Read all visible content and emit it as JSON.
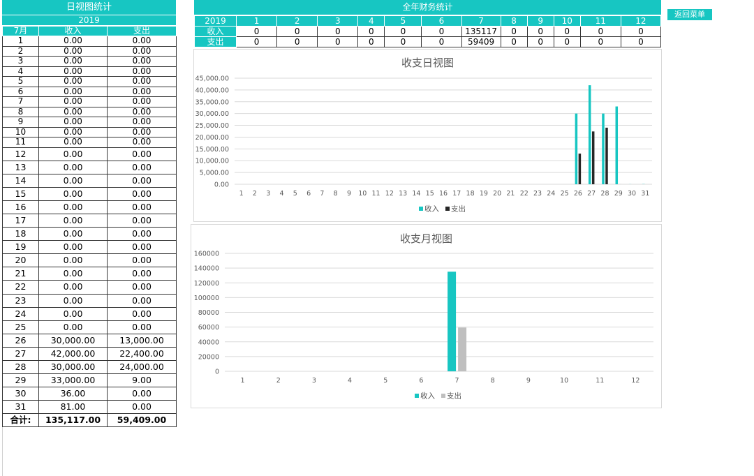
{
  "daily": {
    "title": "日视图统计",
    "year": "2019",
    "month_col": "7月",
    "income_col": "收入",
    "expense_col": "支出",
    "rows": [
      {
        "day": "1",
        "income": "0.00",
        "expense": "0.00"
      },
      {
        "day": "2",
        "income": "0.00",
        "expense": "0.00"
      },
      {
        "day": "3",
        "income": "0.00",
        "expense": "0.00"
      },
      {
        "day": "4",
        "income": "0.00",
        "expense": "0.00"
      },
      {
        "day": "5",
        "income": "0.00",
        "expense": "0.00"
      },
      {
        "day": "6",
        "income": "0.00",
        "expense": "0.00"
      },
      {
        "day": "7",
        "income": "0.00",
        "expense": "0.00"
      },
      {
        "day": "8",
        "income": "0.00",
        "expense": "0.00"
      },
      {
        "day": "9",
        "income": "0.00",
        "expense": "0.00"
      },
      {
        "day": "10",
        "income": "0.00",
        "expense": "0.00"
      },
      {
        "day": "11",
        "income": "0.00",
        "expense": "0.00"
      },
      {
        "day": "12",
        "income": "0.00",
        "expense": "0.00"
      },
      {
        "day": "13",
        "income": "0.00",
        "expense": "0.00"
      },
      {
        "day": "14",
        "income": "0.00",
        "expense": "0.00"
      },
      {
        "day": "15",
        "income": "0.00",
        "expense": "0.00"
      },
      {
        "day": "16",
        "income": "0.00",
        "expense": "0.00"
      },
      {
        "day": "17",
        "income": "0.00",
        "expense": "0.00"
      },
      {
        "day": "18",
        "income": "0.00",
        "expense": "0.00"
      },
      {
        "day": "19",
        "income": "0.00",
        "expense": "0.00"
      },
      {
        "day": "20",
        "income": "0.00",
        "expense": "0.00"
      },
      {
        "day": "21",
        "income": "0.00",
        "expense": "0.00"
      },
      {
        "day": "22",
        "income": "0.00",
        "expense": "0.00"
      },
      {
        "day": "23",
        "income": "0.00",
        "expense": "0.00"
      },
      {
        "day": "24",
        "income": "0.00",
        "expense": "0.00"
      },
      {
        "day": "25",
        "income": "0.00",
        "expense": "0.00"
      },
      {
        "day": "26",
        "income": "30,000.00",
        "expense": "13,000.00"
      },
      {
        "day": "27",
        "income": "42,000.00",
        "expense": "22,400.00"
      },
      {
        "day": "28",
        "income": "30,000.00",
        "expense": "24,000.00"
      },
      {
        "day": "29",
        "income": "33,000.00",
        "expense": "9.00"
      },
      {
        "day": "30",
        "income": "36.00",
        "expense": "0.00"
      },
      {
        "day": "31",
        "income": "81.00",
        "expense": "0.00"
      }
    ],
    "total_label": "合计:",
    "total_income": "135,117.00",
    "total_expense": "59,409.00"
  },
  "annual": {
    "title": "全年财务统计",
    "year": "2019",
    "months": [
      "1",
      "2",
      "3",
      "4",
      "5",
      "6",
      "7",
      "8",
      "9",
      "10",
      "11",
      "12"
    ],
    "income_label": "收入",
    "expense_label": "支出",
    "income": [
      "0",
      "0",
      "0",
      "0",
      "0",
      "0",
      "135117",
      "0",
      "0",
      "0",
      "0",
      "0"
    ],
    "expense": [
      "0",
      "0",
      "0",
      "0",
      "0",
      "0",
      "59409",
      "0",
      "0",
      "0",
      "0",
      "0"
    ]
  },
  "menu_button": "返回菜单",
  "colors": {
    "accent": "#17c6c2",
    "income": "#17c6c2",
    "expense_daily": "#262626",
    "expense_monthly": "#bfbfbf"
  },
  "chart_data": [
    {
      "type": "bar",
      "title": "收支日视图",
      "categories": [
        "1",
        "2",
        "3",
        "4",
        "5",
        "6",
        "7",
        "8",
        "9",
        "10",
        "11",
        "12",
        "13",
        "14",
        "15",
        "16",
        "17",
        "18",
        "19",
        "20",
        "21",
        "22",
        "23",
        "24",
        "25",
        "26",
        "27",
        "28",
        "29",
        "30",
        "31"
      ],
      "series": [
        {
          "name": "收入",
          "values": [
            0,
            0,
            0,
            0,
            0,
            0,
            0,
            0,
            0,
            0,
            0,
            0,
            0,
            0,
            0,
            0,
            0,
            0,
            0,
            0,
            0,
            0,
            0,
            0,
            0,
            30000,
            42000,
            30000,
            33000,
            36,
            81
          ]
        },
        {
          "name": "支出",
          "values": [
            0,
            0,
            0,
            0,
            0,
            0,
            0,
            0,
            0,
            0,
            0,
            0,
            0,
            0,
            0,
            0,
            0,
            0,
            0,
            0,
            0,
            0,
            0,
            0,
            0,
            13000,
            22400,
            24000,
            9,
            0,
            0
          ]
        }
      ],
      "ylim": [
        0,
        45000
      ],
      "yticks": [
        "0.00",
        "5,000.00",
        "10,000.00",
        "15,000.00",
        "20,000.00",
        "25,000.00",
        "30,000.00",
        "35,000.00",
        "40,000.00",
        "45,000.00"
      ],
      "grid": true,
      "legend": "bottom"
    },
    {
      "type": "bar",
      "title": "收支月视图",
      "categories": [
        "1",
        "2",
        "3",
        "4",
        "5",
        "6",
        "7",
        "8",
        "9",
        "10",
        "11",
        "12"
      ],
      "series": [
        {
          "name": "收入",
          "values": [
            0,
            0,
            0,
            0,
            0,
            0,
            135117,
            0,
            0,
            0,
            0,
            0
          ]
        },
        {
          "name": "支出",
          "values": [
            0,
            0,
            0,
            0,
            0,
            0,
            59409,
            0,
            0,
            0,
            0,
            0
          ]
        }
      ],
      "ylim": [
        0,
        160000
      ],
      "yticks": [
        "0",
        "20000",
        "40000",
        "60000",
        "80000",
        "100000",
        "120000",
        "140000",
        "160000"
      ],
      "grid": true,
      "legend": "bottom"
    }
  ]
}
